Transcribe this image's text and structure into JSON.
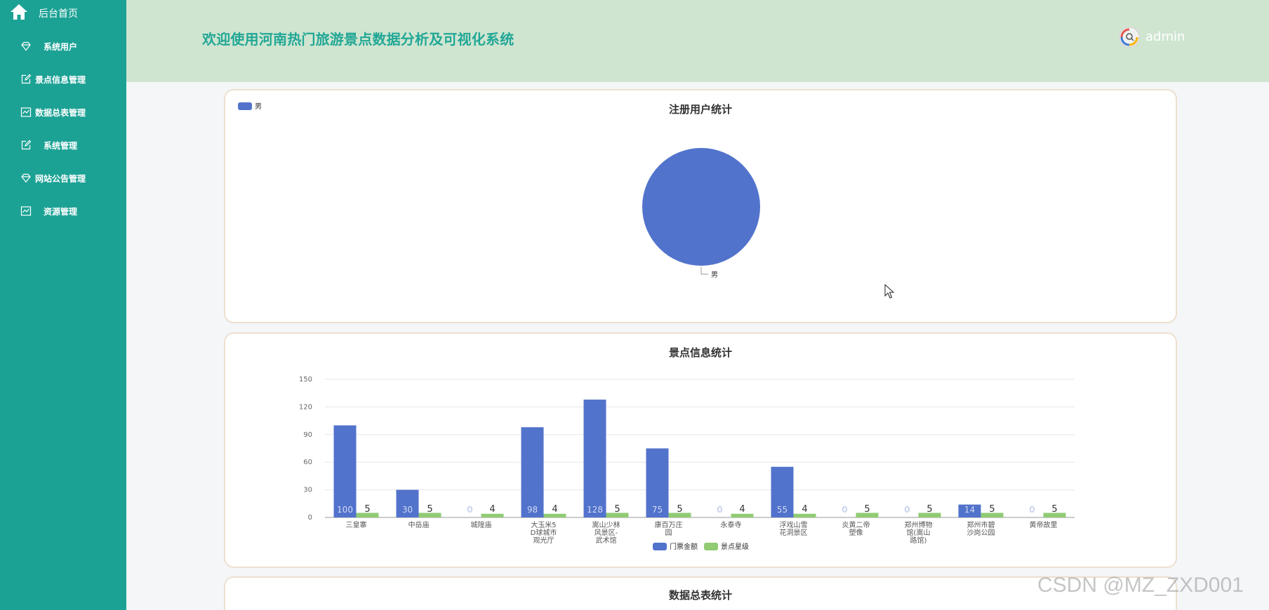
{
  "sidebar": {
    "home_label": "后台首页",
    "items": [
      {
        "label": "系统用户",
        "icon": "diamond-icon"
      },
      {
        "label": "景点信息管理",
        "icon": "edit-icon"
      },
      {
        "label": "数据总表管理",
        "icon": "chart-icon"
      },
      {
        "label": "系统管理",
        "icon": "edit-icon"
      },
      {
        "label": "网站公告管理",
        "icon": "diamond-icon"
      },
      {
        "label": "资源管理",
        "icon": "chart-icon"
      }
    ]
  },
  "header": {
    "title": "欢迎使用河南热门旅游景点数据分析及可视化系统",
    "username": "admin"
  },
  "colors": {
    "sidebar": "#1ca295",
    "header": "#cfe5d0",
    "title": "#22a796",
    "series_blue": "#5273cc",
    "series_green": "#91cb74"
  },
  "panels": {
    "users_title": "注册用户统计",
    "scenic_title": "景点信息统计",
    "summary_title": "数据总表统计"
  },
  "chart_data": [
    {
      "type": "pie",
      "title": "注册用户统计",
      "legend": [
        "男"
      ],
      "legend_position": "top-left",
      "slices": [
        {
          "name": "男",
          "value": 1
        }
      ]
    },
    {
      "type": "bar",
      "title": "景点信息统计",
      "categories": [
        [
          "三皇寨"
        ],
        [
          "中岳庙"
        ],
        [
          "城隍庙"
        ],
        [
          "大玉米5",
          "D球城市",
          "观光厅"
        ],
        [
          "嵩山少林",
          "风景区-",
          "武术馆"
        ],
        [
          "康百万庄",
          "园"
        ],
        [
          "永泰寺"
        ],
        [
          "浮戏山雪",
          "花洞景区"
        ],
        [
          "炎黄二帝",
          "塑像"
        ],
        [
          "郑州博物",
          "馆(嵩山",
          "路馆)"
        ],
        [
          "郑州市碧",
          "沙岗公园"
        ],
        [
          "黄帝故里"
        ]
      ],
      "series": [
        {
          "name": "门票金额",
          "values": [
            100,
            30,
            0,
            98,
            128,
            75,
            0,
            55,
            0,
            0,
            14,
            0
          ]
        },
        {
          "name": "景点星级",
          "values": [
            5,
            5,
            4,
            4,
            5,
            5,
            4,
            4,
            5,
            5,
            5,
            5
          ]
        }
      ],
      "yticks": [
        0,
        30,
        60,
        90,
        120,
        150
      ],
      "ylim": [
        0,
        150
      ],
      "grid": true,
      "legend_position": "bottom-center"
    }
  ],
  "watermark": "CSDN @MZ_ZXD001"
}
